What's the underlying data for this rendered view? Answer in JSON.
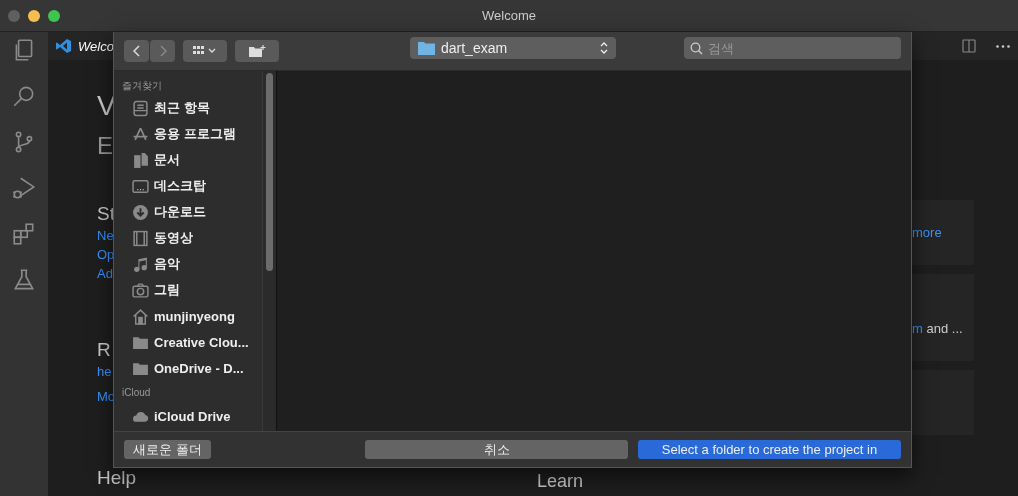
{
  "window": {
    "title": "Welcome"
  },
  "editor": {
    "tab": "Welco",
    "heading": "V",
    "subheading": "E",
    "sections": [
      {
        "title": "St",
        "links": [
          "Ne",
          "Op",
          "Ad"
        ]
      },
      {
        "title": "R",
        "links": [
          "he",
          "Mo"
        ]
      },
      {
        "title": "Help"
      }
    ],
    "learn": "Learn",
    "cards": [
      {
        "kind": "text",
        "link": "more"
      },
      {
        "kind": "text",
        "link": "m",
        "text": "and ..."
      },
      {
        "kind": "blank"
      }
    ]
  },
  "dialog": {
    "location": "dart_exam",
    "search": {
      "placeholder": "검색"
    },
    "sidebar": [
      {
        "title": "즐겨찾기",
        "items": [
          {
            "kind": "recents",
            "label": "최근 항목"
          },
          {
            "kind": "apps",
            "label": "응용 프로그램"
          },
          {
            "kind": "documents",
            "label": "문서"
          },
          {
            "kind": "desktop",
            "label": "데스크탑"
          },
          {
            "kind": "downloads",
            "label": "다운로드"
          },
          {
            "kind": "movies",
            "label": "동영상"
          },
          {
            "kind": "music",
            "label": "음악"
          },
          {
            "kind": "pictures",
            "label": "그림"
          },
          {
            "kind": "home",
            "label": "munjinyeong"
          },
          {
            "kind": "folder",
            "label": "Creative Clou..."
          },
          {
            "kind": "folder",
            "label": "OneDrive - D..."
          }
        ]
      },
      {
        "title": "iCloud",
        "items": [
          {
            "kind": "cloud",
            "label": "iCloud Drive"
          }
        ]
      }
    ],
    "buttons": {
      "new_folder": "새로운 폴더",
      "cancel": "취소",
      "confirm": "Select a folder to create the project in"
    }
  }
}
